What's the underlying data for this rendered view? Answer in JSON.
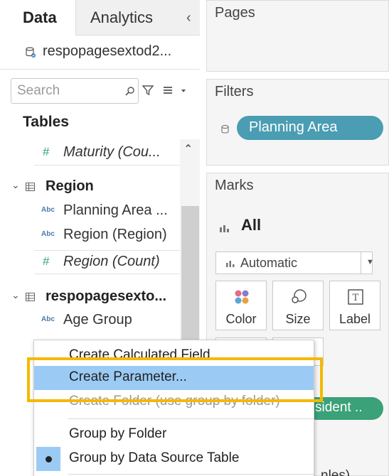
{
  "left_panel": {
    "tabs": [
      {
        "label": "Data"
      },
      {
        "label": "Analytics"
      }
    ],
    "datasource_name": "respopagesextod2...",
    "search": {
      "placeholder": "Search",
      "value": ""
    },
    "tables_title": "Tables",
    "fields": [
      {
        "kind": "measure",
        "name": "Maturity (Cou...",
        "italic": true
      },
      {
        "kind": "group",
        "name": "Region"
      },
      {
        "kind": "dimension",
        "type_label": "Abc",
        "name": "Planning Area ..."
      },
      {
        "kind": "dimension",
        "type_label": "Abc",
        "name": "Region (Region)"
      },
      {
        "kind": "measure",
        "name": "Region (Count)",
        "italic": true
      },
      {
        "kind": "group",
        "name": "respopagesexto..."
      },
      {
        "kind": "dimension",
        "type_label": "Abc",
        "name": "Age Group"
      }
    ]
  },
  "cards": {
    "pages_title": "Pages",
    "filters_title": "Filters",
    "filter_pill": "Planning Area",
    "marks_title": "Marks",
    "marks_all": "All",
    "mark_type": "Automatic",
    "mark_buttons": [
      {
        "label": "Color",
        "icon": "color-dots-icon"
      },
      {
        "label": "Size",
        "icon": "size-icon"
      },
      {
        "label": "Label",
        "icon": "label-icon"
      }
    ],
    "resident_pill": "sident ..",
    "bottom_text": "nles)"
  },
  "context_menu": {
    "items": [
      {
        "label": "Create Calculated Field...",
        "state": "clipped"
      },
      {
        "label": "Create Parameter...",
        "state": "highlighted"
      },
      {
        "label": "Create Folder (use group by folder)",
        "state": "disabled"
      },
      {
        "label": "Group by Folder",
        "state": "normal"
      },
      {
        "label": "Group by Data Source Table",
        "state": "selected"
      }
    ]
  },
  "colors": {
    "filter_pill": "#4a9db2",
    "resident_pill": "#3aa178",
    "highlight_border": "#f5b800",
    "menu_highlight": "#9bcbf4"
  }
}
